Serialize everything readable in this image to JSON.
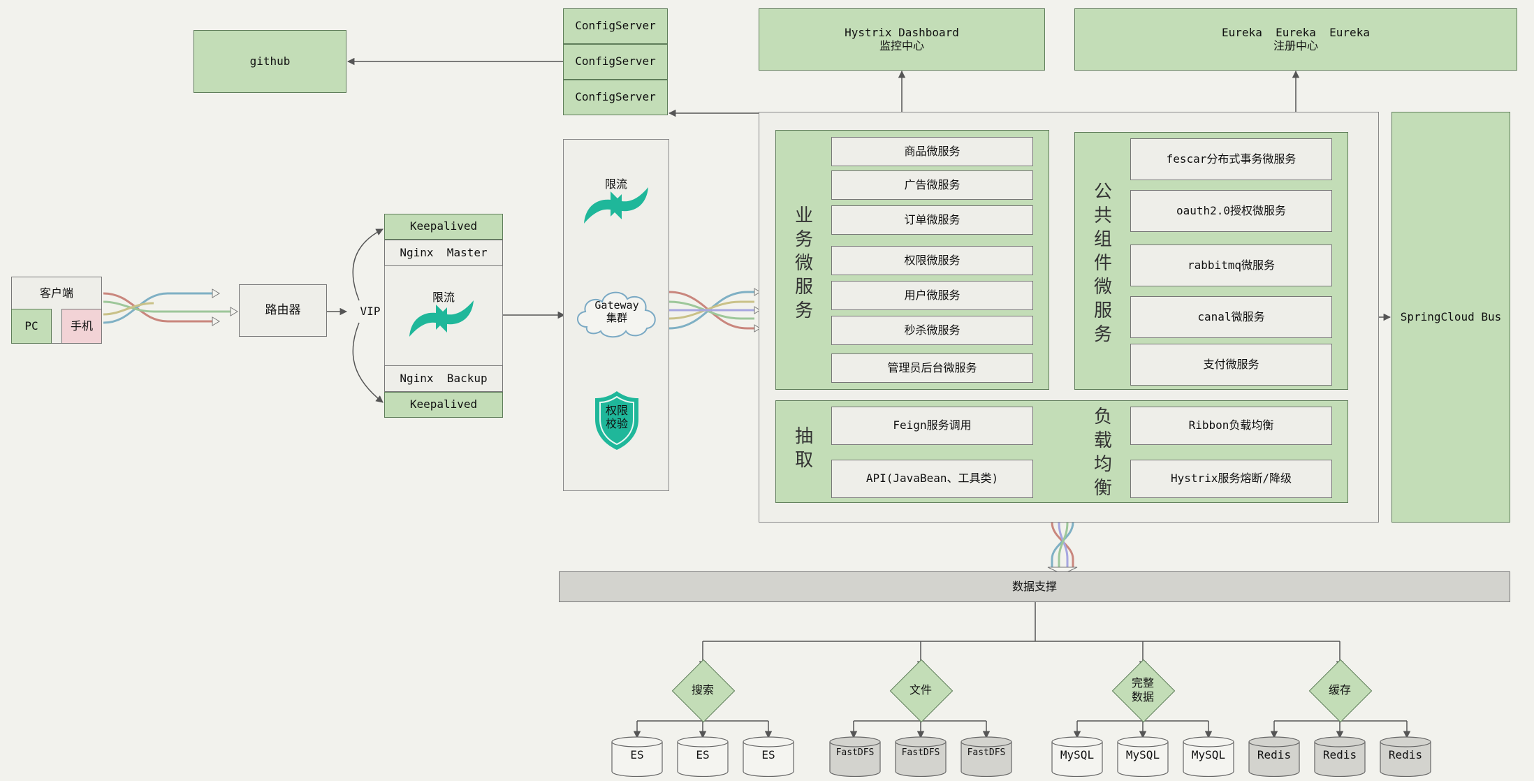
{
  "top": {
    "github": "github",
    "config_servers": [
      "ConfigServer",
      "ConfigServer",
      "ConfigServer"
    ],
    "hystrix_title": "Hystrix Dashboard",
    "hystrix_sub": "监控中心",
    "eureka_title": "Eureka  Eureka  Eureka",
    "eureka_sub": "注册中心"
  },
  "client": {
    "title": "客户端",
    "pc": "PC",
    "phone": "手机"
  },
  "router": "路由器",
  "vip": "VIP",
  "nginx": {
    "keepalived_top": "Keepalived",
    "master": "Nginx  Master",
    "limit": "限流",
    "backup": "Nginx  Backup",
    "keepalived_bottom": "Keepalived"
  },
  "gateway": {
    "limit": "限流",
    "cloud_line1": "Gateway",
    "cloud_line2": "集群",
    "shield_line1": "权限",
    "shield_line2": "校验"
  },
  "business": {
    "vertical": "业务微服务",
    "items": [
      "商品微服务",
      "广告微服务",
      "订单微服务",
      "权限微服务",
      "用户微服务",
      "秒杀微服务",
      "管理员后台微服务"
    ]
  },
  "common": {
    "vertical": "公共组件微服务",
    "items": [
      "fescar分布式事务微服务",
      "oauth2.0授权微服务",
      "rabbitmq微服务",
      "canal微服务",
      "支付微服务"
    ]
  },
  "extract": {
    "vertical": "抽取",
    "items": [
      "Feign服务调用",
      "API(JavaBean、工具类)"
    ]
  },
  "balance": {
    "vertical": "负载均衡",
    "items": [
      "Ribbon负载均衡",
      "Hystrix服务熔断/降级"
    ]
  },
  "bus": "SpringCloud Bus",
  "data_support": "数据支撑",
  "storage": [
    {
      "category": "搜索",
      "items": [
        "ES",
        "ES",
        "ES"
      ]
    },
    {
      "category": "文件",
      "items": [
        "FastDFS",
        "FastDFS",
        "FastDFS"
      ]
    },
    {
      "category": "完整数据",
      "items": [
        "MySQL",
        "MySQL",
        "MySQL"
      ]
    },
    {
      "category": "缓存",
      "items": [
        "Redis",
        "Redis",
        "Redis"
      ]
    }
  ],
  "colors": {
    "box_green": "#c3ddb7",
    "box_white": "#eeeee9",
    "box_gray": "#d3d3ce",
    "phone_pink": "#f2d3d6",
    "teal_icon": "#1fb79a",
    "line": "#555555"
  },
  "icons": [
    "refresh-arrows-icon",
    "cloud-icon",
    "shield-icon",
    "database-icon"
  ]
}
